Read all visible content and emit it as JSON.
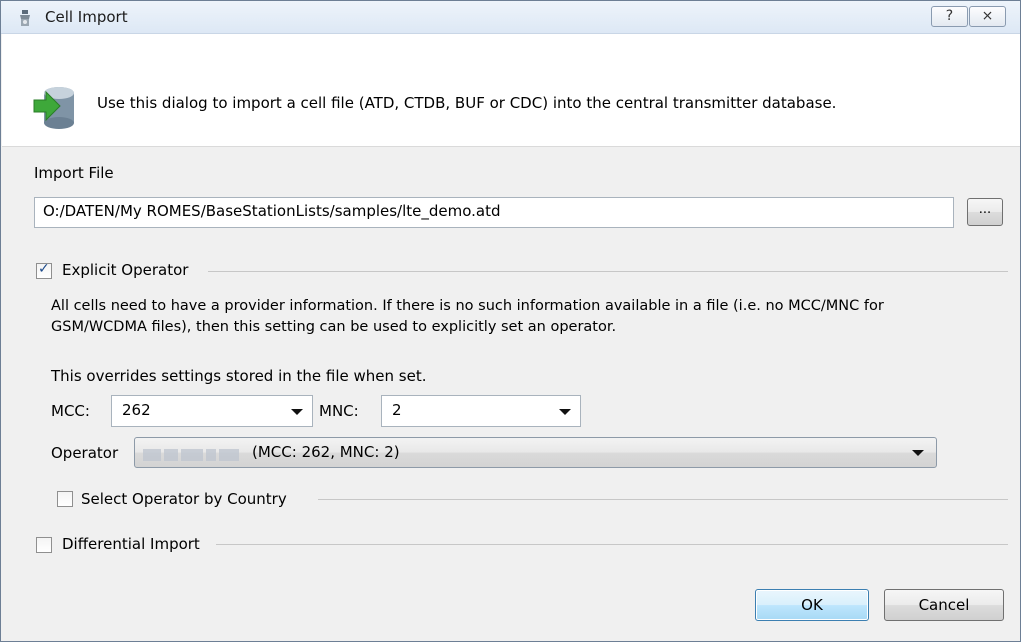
{
  "window": {
    "title": "Cell Import",
    "help_glyph": "?",
    "close_glyph": "⨯"
  },
  "banner": {
    "icon": "database-import-icon",
    "text": "Use this dialog to import a cell file (ATD, CTDB, BUF or CDC) into the central transmitter database."
  },
  "import_file": {
    "label": "Import File",
    "path": "O:/DATEN/My ROMES/BaseStationLists/samples/lte_demo.atd",
    "browse_label": "..."
  },
  "explicit_operator": {
    "label": "Explicit Operator",
    "checked": true,
    "description_line1": "All cells need to have a provider information. If there is no such information available in a file (i.e. no MCC/MNC for",
    "description_line2": "GSM/WCDMA files), then this setting can be used to explicitly set an operator.",
    "note": "This overrides settings stored in the file when set.",
    "mcc_label": "MCC:",
    "mcc_value": "262",
    "mnc_label": "MNC:",
    "mnc_value": "2",
    "operator_label": "Operator",
    "operator_value": "(MCC: 262, MNC: 2)"
  },
  "select_by_country": {
    "label": "Select Operator by Country",
    "checked": false
  },
  "differential_import": {
    "label": "Differential Import",
    "checked": false
  },
  "buttons": {
    "ok": "OK",
    "cancel": "Cancel"
  },
  "colors": {
    "accent": "#3c7fb1",
    "titlebar": "#dde8f5"
  }
}
